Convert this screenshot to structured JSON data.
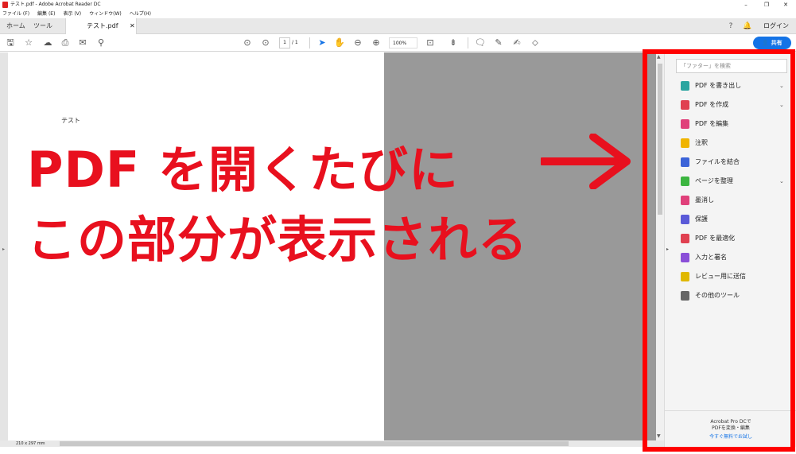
{
  "window": {
    "title": "テスト.pdf - Adobe Acrobat Reader DC",
    "controls": [
      "–",
      "❐",
      "✕"
    ]
  },
  "menu": {
    "items": [
      "ファイル (F)",
      "編集 (E)",
      "表示 (V)",
      "ウィンドウ(W)",
      "ヘルプ(H)"
    ]
  },
  "tabs": {
    "home": "ホーム",
    "tools": "ツール",
    "document": "テスト.pdf",
    "close": "✕",
    "login": "ログイン"
  },
  "toolbar": {
    "page_current": "1",
    "page_total": "/ 1",
    "zoom": "100%",
    "share": "共有"
  },
  "document": {
    "page_text": "テスト",
    "page_size": "210 x 297 mm"
  },
  "tools_pane": {
    "search_placeholder": "「ファター」を検索",
    "items": [
      {
        "label": "PDF を書き出し",
        "icon": "export-pdf-icon",
        "color": "#2aa5a0",
        "has_menu": true
      },
      {
        "label": "PDF を作成",
        "icon": "create-pdf-icon",
        "color": "#e04050",
        "has_menu": true
      },
      {
        "label": "PDF を編集",
        "icon": "edit-pdf-icon",
        "color": "#e0407a",
        "has_menu": false
      },
      {
        "label": "注釈",
        "icon": "comment-icon",
        "color": "#f0b400",
        "has_menu": false
      },
      {
        "label": "ファイルを結合",
        "icon": "combine-files-icon",
        "color": "#3b63d8",
        "has_menu": false
      },
      {
        "label": "ページを整理",
        "icon": "organize-pages-icon",
        "color": "#3cb540",
        "has_menu": true
      },
      {
        "label": "墨消し",
        "icon": "redact-icon",
        "color": "#e0407a",
        "has_menu": false
      },
      {
        "label": "保護",
        "icon": "protect-icon",
        "color": "#5a5ad8",
        "has_menu": false
      },
      {
        "label": "PDF を最適化",
        "icon": "optimize-pdf-icon",
        "color": "#e04050",
        "has_menu": false
      },
      {
        "label": "入力と署名",
        "icon": "fill-sign-icon",
        "color": "#8a4fd8",
        "has_menu": false
      },
      {
        "label": "レビュー用に送信",
        "icon": "send-review-icon",
        "color": "#e0b800",
        "has_menu": false
      },
      {
        "label": "その他のツール",
        "icon": "more-tools-icon",
        "color": "#666666",
        "has_menu": false
      }
    ],
    "promo_line1": "Acrobat Pro DCで",
    "promo_line2": "PDFを変換・編集",
    "promo_link": "今すぐ無料でお試し"
  },
  "annotation": {
    "line1": "PDF を開くたびに",
    "line2": "この部分が表示される",
    "color": "#e8101e"
  }
}
